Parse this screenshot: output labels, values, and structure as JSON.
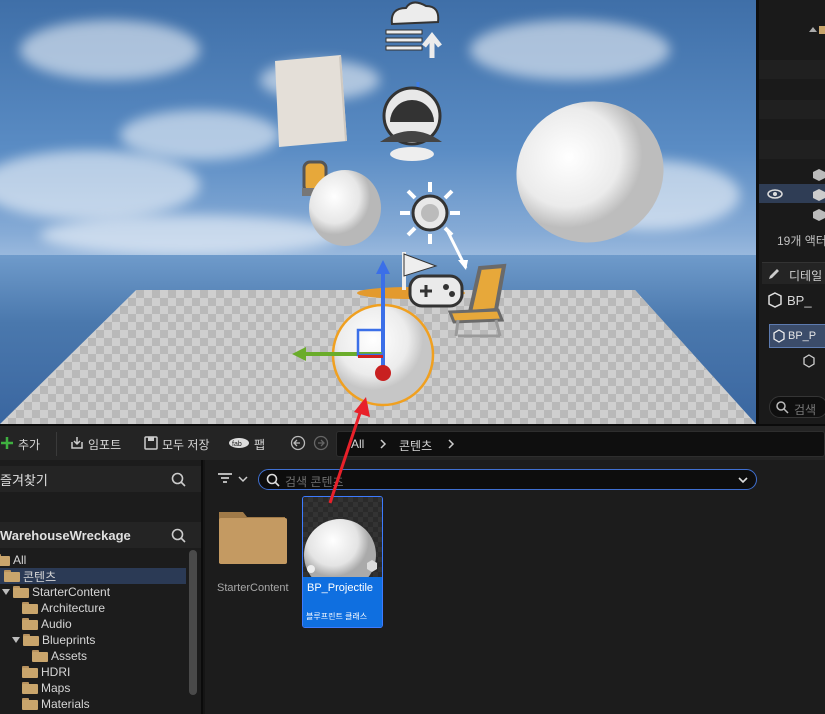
{
  "outliner": {
    "actor_count": "19개 액터"
  },
  "details": {
    "tab_title": "디테일",
    "actor_name": "BP_",
    "component": "BP_P",
    "search_placeholder": "검색"
  },
  "toolbar": {
    "add_label": "추가",
    "import_label": "임포트",
    "save_all_label": "모두 저장",
    "fab_label": "팹",
    "breadcrumb": [
      "All",
      "콘텐츠"
    ]
  },
  "sources": {
    "favorites_title": "즐겨찾기",
    "project_title": "WarehouseWreckage",
    "tree": [
      {
        "label": "All"
      },
      {
        "label": "콘텐츠"
      },
      {
        "label": "StarterContent"
      },
      {
        "label": "Architecture"
      },
      {
        "label": "Audio"
      },
      {
        "label": "Blueprints"
      },
      {
        "label": "Assets"
      },
      {
        "label": "HDRI"
      },
      {
        "label": "Maps"
      },
      {
        "label": "Materials"
      }
    ]
  },
  "assets": {
    "search_placeholder": "검색 콘텐츠",
    "items": [
      {
        "name": "StarterContent",
        "type": ""
      },
      {
        "name": "BP_Projectile",
        "type": "블루프린트 클래스"
      }
    ]
  },
  "colors": {
    "accent": "#0f6fe0",
    "selection": "#2b3a55",
    "folder": "#c9a56c",
    "annotation_arrow": "#e8202a"
  }
}
